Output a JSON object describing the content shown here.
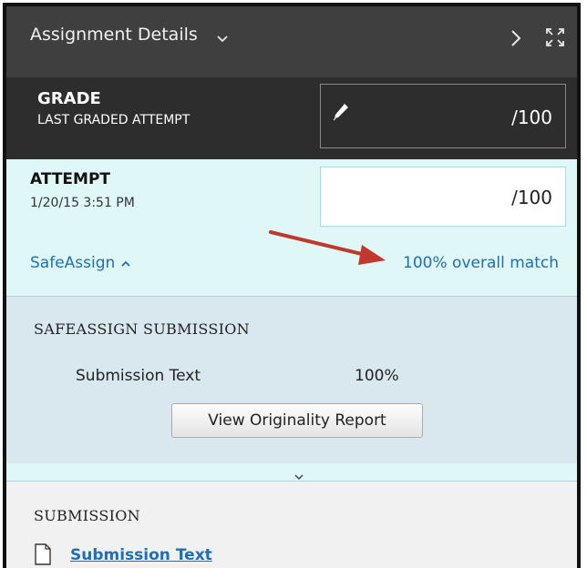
{
  "header": {
    "title": "Assignment Details",
    "caret_icon": "chevron-down-icon",
    "next_icon": "chevron-right-icon",
    "expand_icon": "expand-icon"
  },
  "grade": {
    "title": "GRADE",
    "subtitle": "LAST GRADED ATTEMPT",
    "value": "/100",
    "edit_icon": "pencil-icon"
  },
  "attempt": {
    "title": "ATTEMPT",
    "date": "1/20/15 3:51 PM",
    "value": "/100"
  },
  "safeassign": {
    "toggle_label": "SafeAssign",
    "toggle_icon": "chevron-up-icon",
    "overall_match": "100% overall match",
    "annotation": "red-arrow",
    "section_title": "SAFEASSIGN SUBMISSION",
    "item": {
      "name": "Submission Text",
      "percent": "100%"
    },
    "report_button": "View Originality Report"
  },
  "collapse_icon": "chevron-down-icon",
  "submission": {
    "section_title": "SUBMISSION",
    "file_icon": "document-icon",
    "link": "Submission Text"
  },
  "colors": {
    "header_bg": "#3f3f3f",
    "grade_bg": "#2d2d2d",
    "attempt_bg": "#e0f7f7",
    "safeassign_bg": "#d8e8ee",
    "link": "#1f6fb5",
    "arrow": "#c0392b"
  }
}
